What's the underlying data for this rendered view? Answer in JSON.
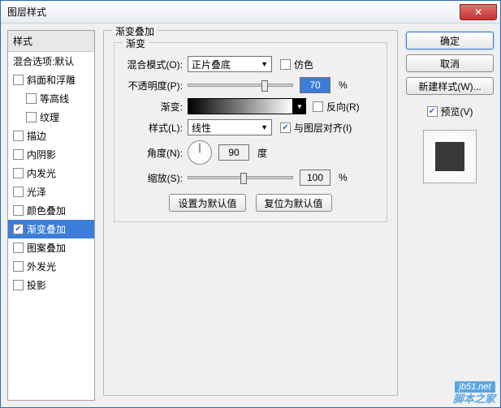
{
  "title": "图层样式",
  "left": {
    "head": "样式",
    "blend": "混合选项:默认",
    "items": [
      {
        "label": "斜面和浮雕",
        "indent": false
      },
      {
        "label": "等高线",
        "indent": true
      },
      {
        "label": "纹理",
        "indent": true
      },
      {
        "label": "描边",
        "indent": false
      },
      {
        "label": "内阴影",
        "indent": false
      },
      {
        "label": "内发光",
        "indent": false
      },
      {
        "label": "光泽",
        "indent": false
      },
      {
        "label": "颜色叠加",
        "indent": false
      },
      {
        "label": "渐变叠加",
        "indent": false,
        "checked": true,
        "selected": true
      },
      {
        "label": "图案叠加",
        "indent": false
      },
      {
        "label": "外发光",
        "indent": false
      },
      {
        "label": "投影",
        "indent": false
      }
    ]
  },
  "group": {
    "title": "渐变叠加",
    "inner": "渐变",
    "blendModeLabel": "混合模式(O):",
    "blendMode": "正片叠底",
    "dither": "仿色",
    "opacityLabel": "不透明度(P):",
    "opacity": "70",
    "pct": "%",
    "gradientLabel": "渐变:",
    "reverse": "反向(R)",
    "styleLabel": "样式(L):",
    "style": "线性",
    "align": "与图层对齐(I)",
    "angleLabel": "角度(N):",
    "angle": "90",
    "degree": "度",
    "scaleLabel": "缩放(S):",
    "scale": "100",
    "btnDefault": "设置为默认值",
    "btnReset": "复位为默认值"
  },
  "right": {
    "ok": "确定",
    "cancel": "取消",
    "newStyle": "新建样式(W)...",
    "preview": "预览(V)"
  },
  "watermark": "脚本之家",
  "watermark2": "jb51.net"
}
